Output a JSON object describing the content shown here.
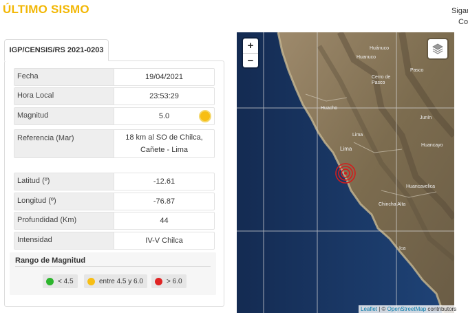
{
  "header": {
    "title": "ÚLTIMO SISMO",
    "right_line1": "Sigar",
    "right_line2": "Co"
  },
  "tab": {
    "label": "IGP/CENSIS/RS 2021-0203"
  },
  "details": [
    {
      "label": "Fecha",
      "value": "19/04/2021"
    },
    {
      "label": "Hora Local",
      "value": "23:53:29"
    },
    {
      "label": "Magnitud",
      "value": "5.0"
    },
    {
      "label": "Referencia (Mar)",
      "value": "18 km al SO de Chilca, Cañete - Lima"
    },
    {
      "label": "Latitud (º)",
      "value": "-12.61"
    },
    {
      "label": "Longitud (º)",
      "value": "-76.87"
    },
    {
      "label": "Profundidad (Km)",
      "value": "44"
    },
    {
      "label": "Intensidad",
      "value": "IV-V Chilca"
    }
  ],
  "range": {
    "title": "Rango de Magnitud",
    "items": [
      {
        "label": "< 4.5",
        "color": "#2db52d"
      },
      {
        "label": "entre 4.5 y 6.0",
        "color": "#f7be14"
      },
      {
        "label": "> 6.0",
        "color": "#e02424"
      }
    ]
  },
  "map": {
    "zoom_in": "+",
    "zoom_out": "−",
    "attribution_leaflet": "Leaflet",
    "attribution_sep": " | © ",
    "attribution_osm": "OpenStreetMap",
    "attribution_tail": " contributors",
    "cities": [
      "Huanuco",
      "Huánuco",
      "Pasco",
      "Cerro de Pasco",
      "Huacho",
      "Junín",
      "Lima",
      "Huancayo",
      "Lima",
      "Huancavelica",
      "Chincha Alta",
      "Ica"
    ]
  }
}
